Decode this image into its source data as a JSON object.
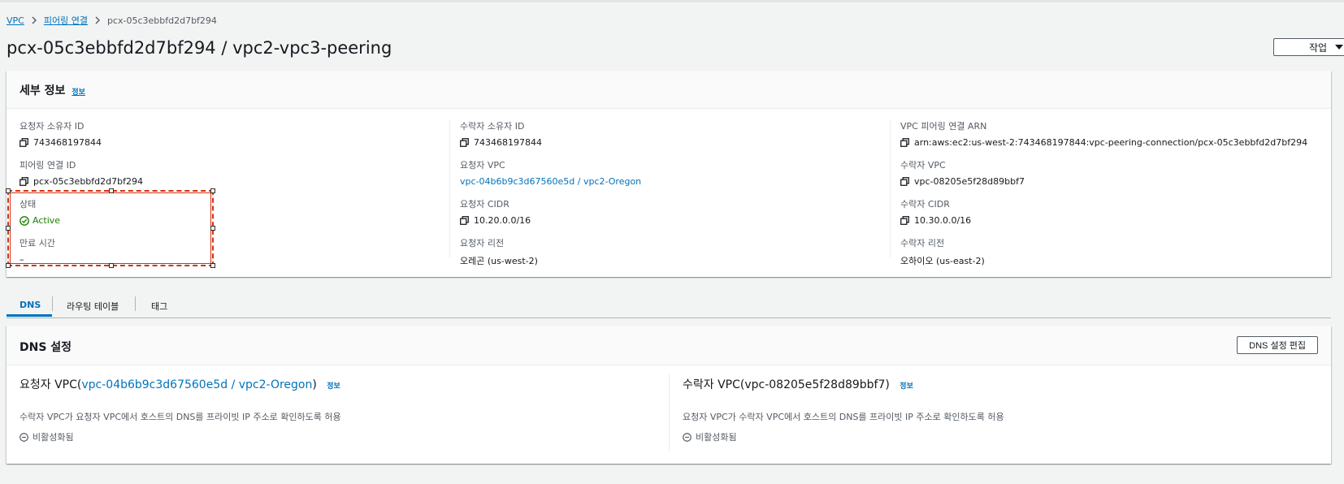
{
  "breadcrumb": {
    "items": [
      "VPC",
      "피어링 연결"
    ],
    "current": "pcx-05c3ebbfd2d7bf294"
  },
  "page": {
    "title": "pcx-05c3ebbfd2d7bf294 / vpc2-vpc3-peering",
    "actions_label": "작업"
  },
  "details": {
    "title": "세부 정보",
    "info_label": "정보",
    "col1": {
      "requester_owner_label": "요청자 소유자 ID",
      "requester_owner_value": "743468197844",
      "peering_id_label": "피어링 연결 ID",
      "peering_id_value": "pcx-05c3ebbfd2d7bf294",
      "status_label": "상태",
      "status_value": "Active",
      "expiry_label": "만료 시간",
      "expiry_value": "–"
    },
    "col2": {
      "accepter_owner_label": "수락자 소유자 ID",
      "accepter_owner_value": "743468197844",
      "requester_vpc_label": "요청자 VPC",
      "requester_vpc_value": "vpc-04b6b9c3d67560e5d / vpc2-Oregon",
      "requester_cidr_label": "요청자 CIDR",
      "requester_cidr_value": "10.20.0.0/16",
      "requester_region_label": "요청자 리전",
      "requester_region_value": "오레곤 (us-west-2)"
    },
    "col3": {
      "arn_label": "VPC 피어링 연결 ARN",
      "arn_value": "arn:aws:ec2:us-west-2:743468197844:vpc-peering-connection/pcx-05c3ebbfd2d7bf294",
      "accepter_vpc_label": "수락자 VPC",
      "accepter_vpc_value": "vpc-08205e5f28d89bbf7",
      "accepter_cidr_label": "수락자 CIDR",
      "accepter_cidr_value": "10.30.0.0/16",
      "accepter_region_label": "수락자 리전",
      "accepter_region_value": "오하이오 (us-east-2)"
    }
  },
  "tabs": [
    {
      "label": "DNS",
      "active": true
    },
    {
      "label": "라우팅 테이블",
      "active": false
    },
    {
      "label": "태그",
      "active": false
    }
  ],
  "dns": {
    "title": "DNS 설정",
    "edit_label": "DNS 설정 편집",
    "requester": {
      "heading_prefix": "요청자 VPC(",
      "heading_link": "vpc-04b6b9c3d67560e5d / vpc2-Oregon",
      "heading_suffix": ")",
      "info_label": "정보",
      "description": "수락자 VPC가 요청자 VPC에서 호스트의 DNS를 프라이빗 IP 주소로 확인하도록 허용",
      "state": "비활성화됨"
    },
    "accepter": {
      "heading": "수락자 VPC(vpc-08205e5f28d89bbf7)",
      "info_label": "정보",
      "description": "요청자 VPC가 수락자 VPC에서 호스트의 DNS를 프라이빗 IP 주소로 확인하도록 허용",
      "state": "비활성화됨"
    }
  },
  "colors": {
    "link": "#0073bb",
    "success": "#1d8102",
    "highlight": "#d13212"
  }
}
